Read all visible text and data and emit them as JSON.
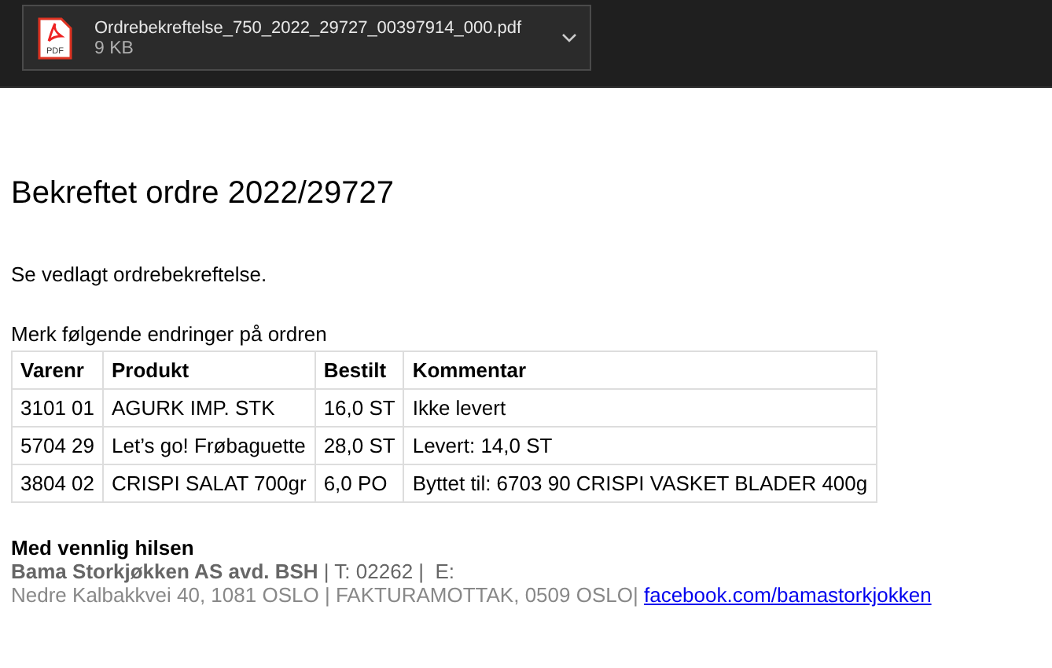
{
  "attachment": {
    "file_name": "Ordrebekreftelse_750_2022_29727_00397914_000.pdf",
    "file_size": "9 KB",
    "icon_label": "PDF"
  },
  "email": {
    "heading": "Bekreftet ordre 2022/29727",
    "intro": "Se vedlagt ordrebekreftelse.",
    "table_caption": "Merk følgende endringer på ordren",
    "table": {
      "columns": [
        "Varenr",
        "Produkt",
        "Bestilt",
        "Kommentar"
      ],
      "rows": [
        [
          "3101 01",
          "AGURK IMP. STK",
          "16,0 ST",
          "Ikke levert"
        ],
        [
          "5704 29",
          "Let’s go! Frøbaguette",
          "28,0 ST",
          "Levert: 14,0 ST"
        ],
        [
          "3804 02",
          "CRISPI SALAT 700gr",
          "6,0 PO",
          "Byttet til: 6703 90 CRISPI VASKET BLADER 400g"
        ]
      ]
    },
    "signature": {
      "greeting": "Med vennlig hilsen",
      "company_line": "**Bama Storkjøkken AS avd. BSH** | T: 02262 |  E:",
      "address": "Nedre Kalbakkvei 40, 1081 OSLO | FAKTURAMOTTAK, 0509 OSLO|",
      "link": "facebook.com/bamastorkjokken"
    }
  }
}
